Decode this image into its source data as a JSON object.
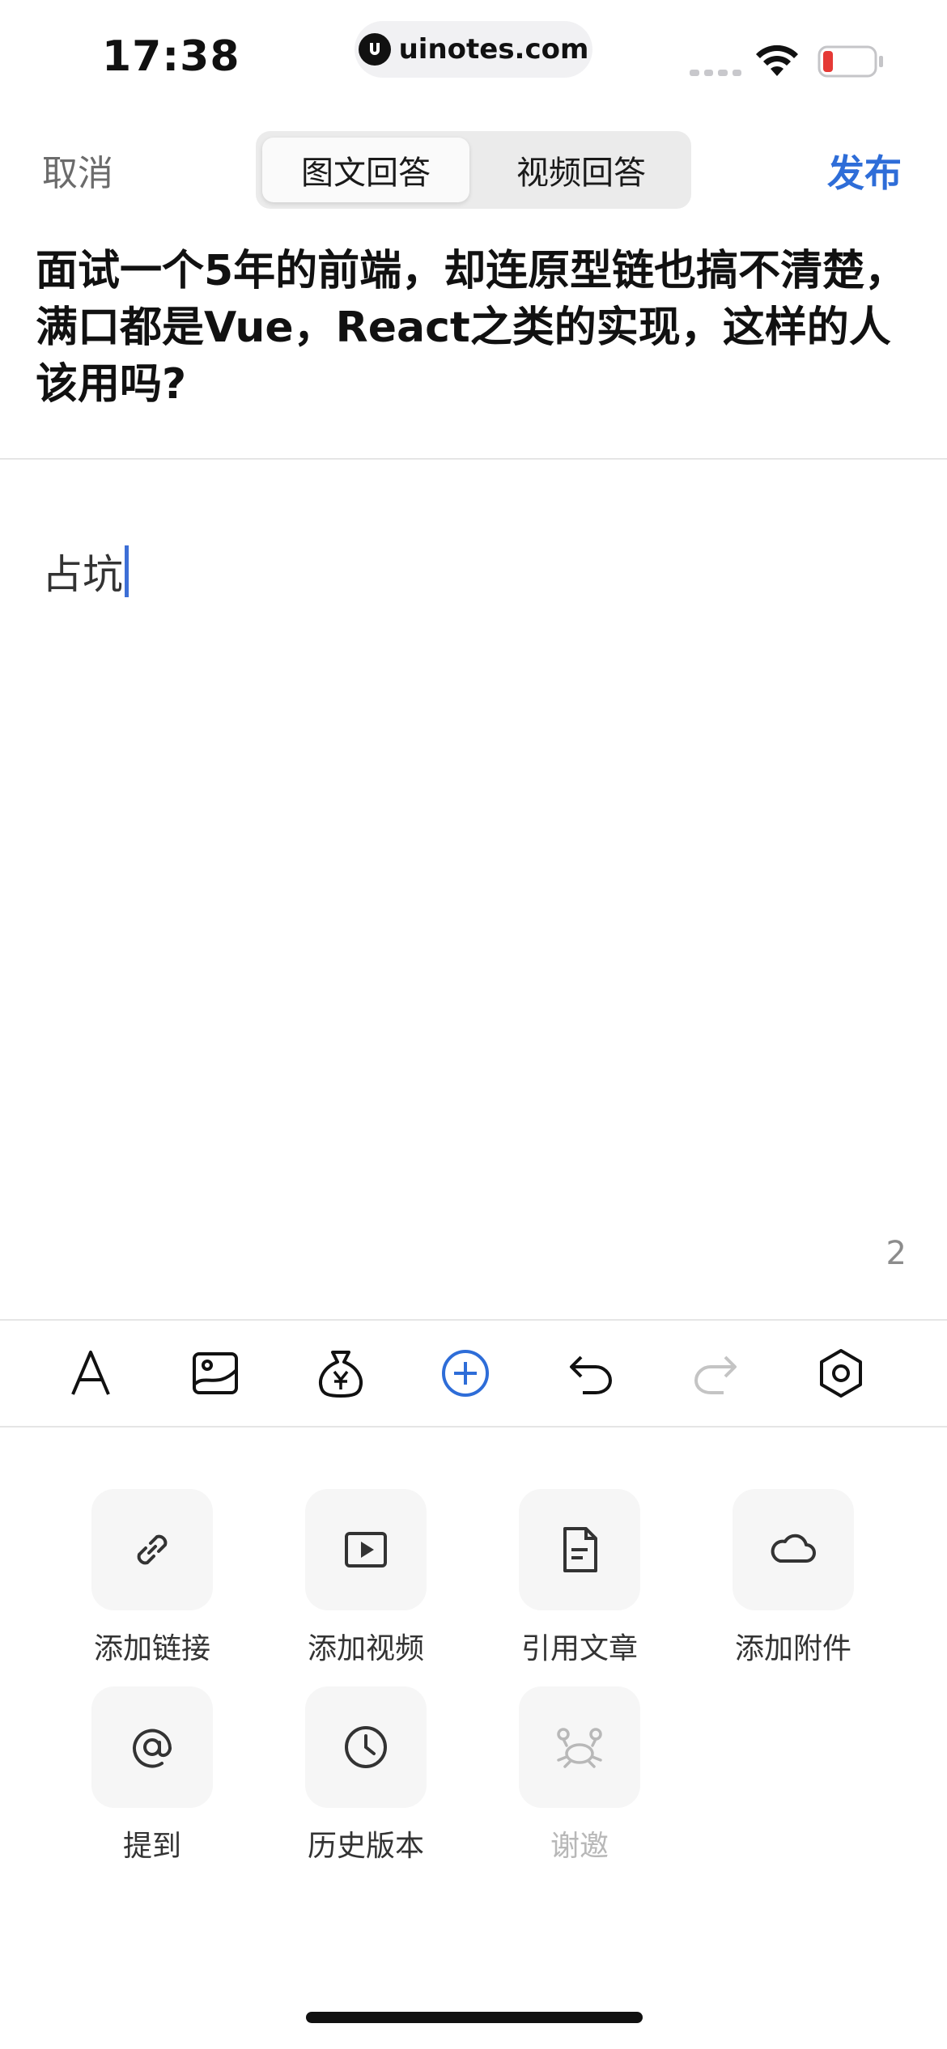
{
  "status_bar": {
    "time": "17:38",
    "url": "uinotes.com",
    "icons": [
      "signal-icon",
      "wifi-icon",
      "battery-low-icon"
    ]
  },
  "header": {
    "cancel_label": "取消",
    "tabs": [
      {
        "label": "图文回答",
        "active": true
      },
      {
        "label": "视频回答",
        "active": false
      }
    ],
    "publish_label": "发布"
  },
  "question": {
    "title": "面试一个5年的前端，却连原型链也搞不清楚，满口都是Vue，React之类的实现，这样的人该用吗?"
  },
  "editor": {
    "content": "占坑",
    "word_count": "2"
  },
  "toolbar": {
    "items": [
      {
        "icon": "text-format-icon",
        "enabled": true
      },
      {
        "icon": "image-icon",
        "enabled": true
      },
      {
        "icon": "reward-bag-icon",
        "enabled": true
      },
      {
        "icon": "add-circle-icon",
        "enabled": true,
        "active": true
      },
      {
        "icon": "undo-icon",
        "enabled": true
      },
      {
        "icon": "redo-icon",
        "enabled": false
      },
      {
        "icon": "settings-hexagon-icon",
        "enabled": true
      }
    ]
  },
  "actions": [
    {
      "label": "添加链接",
      "icon": "link-icon",
      "enabled": true
    },
    {
      "label": "添加视频",
      "icon": "video-icon",
      "enabled": true
    },
    {
      "label": "引用文章",
      "icon": "document-icon",
      "enabled": true
    },
    {
      "label": "添加附件",
      "icon": "cloud-icon",
      "enabled": true
    },
    {
      "label": "提到",
      "icon": "at-icon",
      "enabled": true
    },
    {
      "label": "历史版本",
      "icon": "clock-icon",
      "enabled": true
    },
    {
      "label": "谢邀",
      "icon": "crab-icon",
      "enabled": false
    }
  ],
  "colors": {
    "accent": "#2e6dd8",
    "caret": "#3d6fd6",
    "battery_low": "#e53935",
    "disabled": "#b8b8b8"
  }
}
